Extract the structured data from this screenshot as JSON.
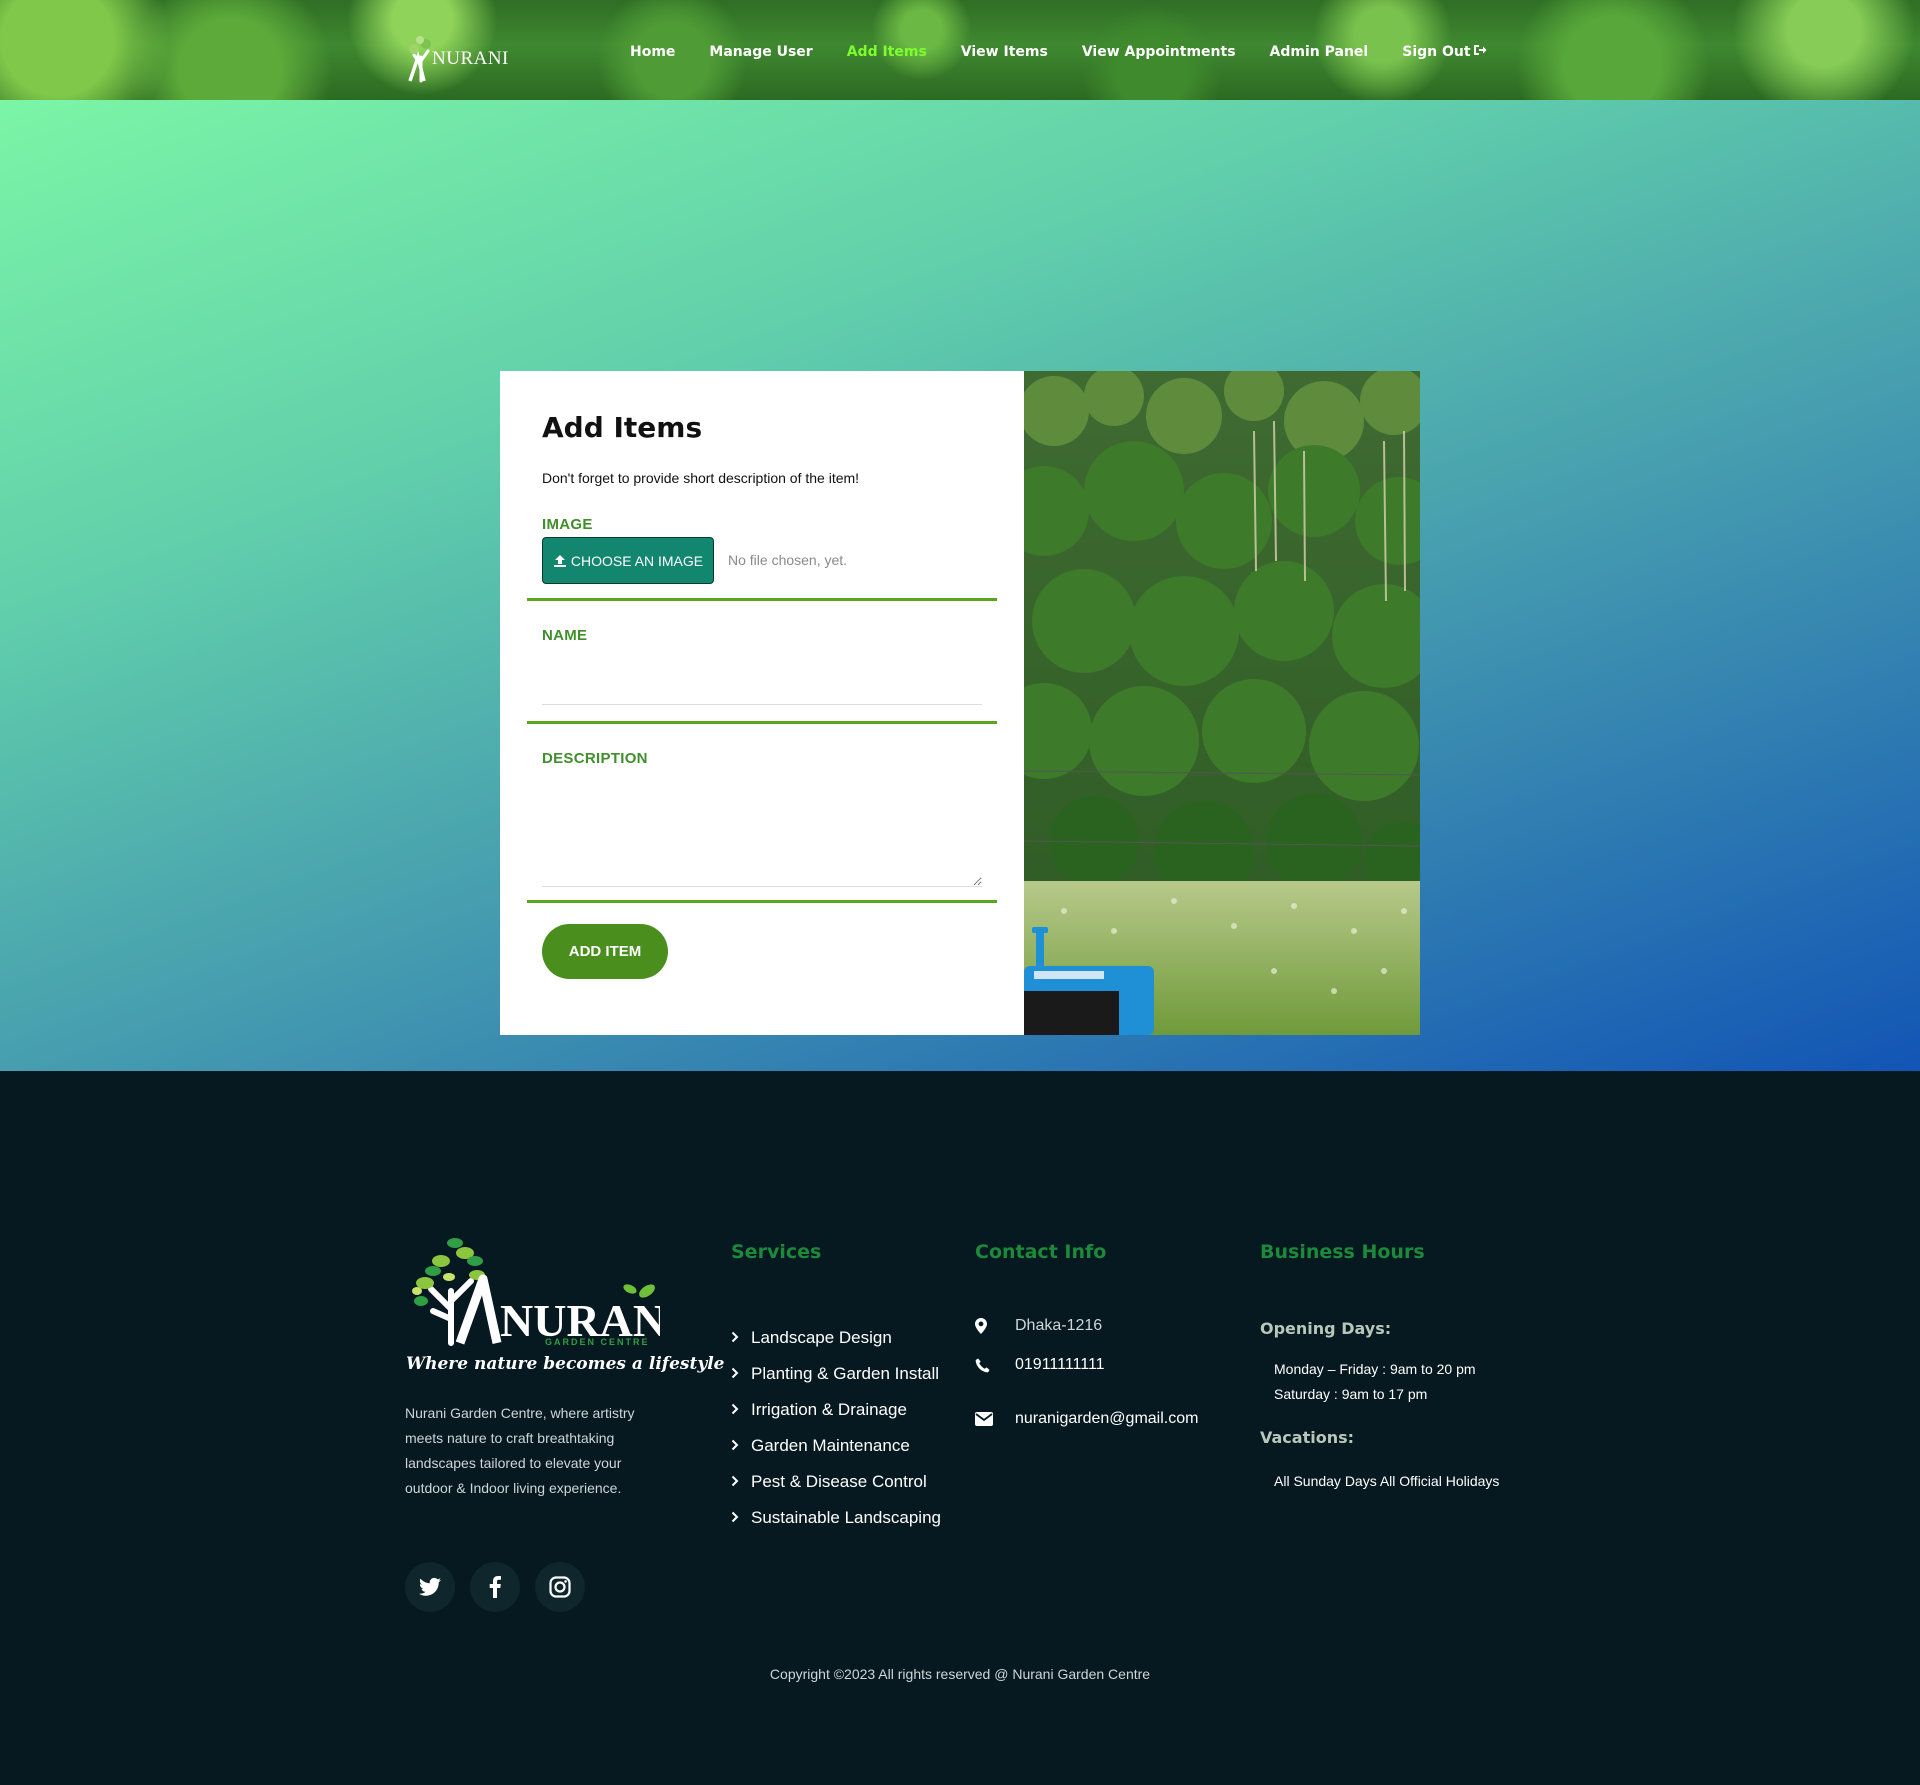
{
  "brand": {
    "name": "NURANI",
    "subtitle": "GARDEN CENTRE",
    "tagline": "Where nature becomes a lifestyle"
  },
  "nav": {
    "items": [
      {
        "label": "Home",
        "active": false
      },
      {
        "label": "Manage User",
        "active": false
      },
      {
        "label": "Add Items",
        "active": true
      },
      {
        "label": "View Items",
        "active": false
      },
      {
        "label": "View Appointments",
        "active": false
      },
      {
        "label": "Admin Panel",
        "active": false
      },
      {
        "label": "Sign Out",
        "active": false
      }
    ]
  },
  "form": {
    "title": "Add Items",
    "subtitle": "Don't forget to provide short description of the item!",
    "image_label": "IMAGE",
    "choose_button": "CHOOSE AN IMAGE",
    "no_file_text": "No file chosen, yet.",
    "name_label": "NAME",
    "name_value": "",
    "description_label": "DESCRIPTION",
    "description_value": "",
    "submit_label": "ADD ITEM"
  },
  "footer": {
    "about": "Nurani Garden Centre, where artistry meets nature to craft breathtaking landscapes tailored to elevate your outdoor & Indoor living experience.",
    "socials": [
      "twitter-icon",
      "facebook-icon",
      "instagram-icon"
    ],
    "services_heading": "Services",
    "services": [
      "Landscape Design",
      "Planting & Garden Install",
      "Irrigation & Drainage",
      "Garden Maintenance",
      "Pest & Disease Control",
      "Sustainable Landscaping"
    ],
    "contact_heading": "Contact Info",
    "contact": {
      "address": "Dhaka-1216",
      "phone": "01911111111",
      "email": "nuranigarden@gmail.com"
    },
    "hours_heading": "Business Hours",
    "opening_label": "Opening Days:",
    "weekday_hours": "Monday – Friday : 9am to 20 pm",
    "saturday_hours": "Saturday : 9am to 17 pm",
    "vacations_label": "Vacations:",
    "vacations_text": "All Sunday Days All Official Holidays",
    "copyright": "Copyright ©2023 All rights reserved @ Nurani Garden Centre"
  },
  "colors": {
    "accent_green": "#3f8f2a",
    "active_nav": "#7dff2e",
    "choose_button": "#12866e",
    "footer_bg": "#061820",
    "footer_heading": "#1b8a3a"
  }
}
